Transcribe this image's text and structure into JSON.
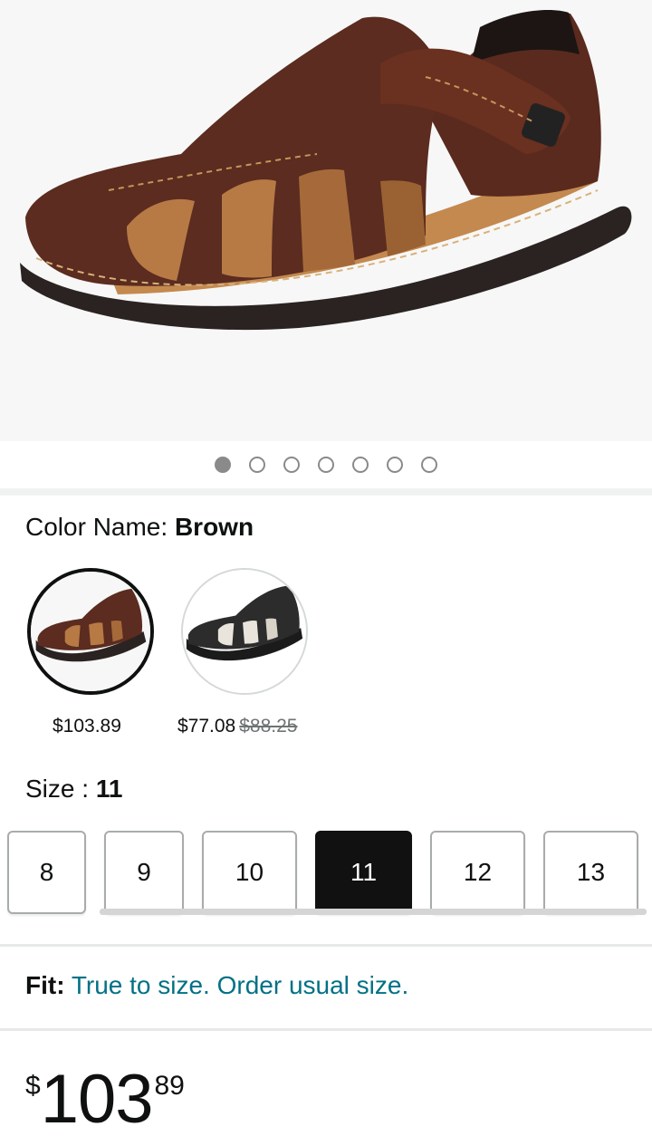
{
  "product": {
    "image_alt": "Brown leather fisherman sandal",
    "carousel": {
      "count": 7,
      "active_index": 0
    }
  },
  "color": {
    "label": "Color Name:",
    "value": "Brown",
    "swatches": [
      {
        "name": "Brown",
        "price": "$103.89",
        "list_price": "",
        "selected": true
      },
      {
        "name": "Black",
        "price": "$77.08",
        "list_price": "$88.25",
        "selected": false
      }
    ]
  },
  "size": {
    "label": "Size :",
    "value": "11",
    "options": [
      "8",
      "9",
      "10",
      "11",
      "12",
      "13"
    ],
    "selected": "11"
  },
  "fit": {
    "label": "Fit:",
    "text": "True to size. Order usual size."
  },
  "price": {
    "symbol": "$",
    "whole": "103",
    "fraction": "89"
  },
  "colors": {
    "link": "#007185",
    "text": "#0f1111",
    "selected_size_bg": "#111111"
  }
}
